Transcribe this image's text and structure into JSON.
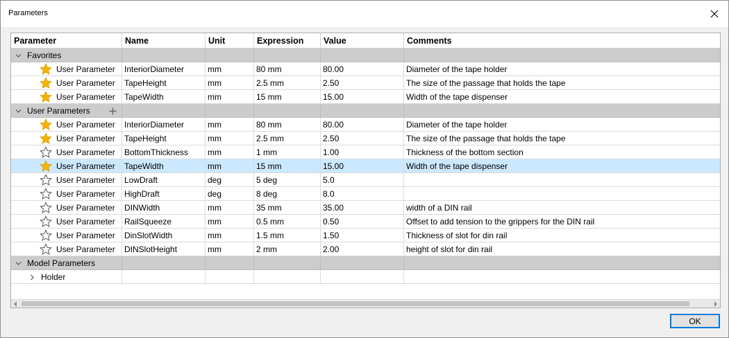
{
  "window": {
    "title": "Parameters"
  },
  "columns": [
    "Parameter",
    "Name",
    "Unit",
    "Expression",
    "Value",
    "Comments"
  ],
  "groups": {
    "favorites": {
      "label": "Favorites"
    },
    "user": {
      "label": "User Parameters"
    },
    "model": {
      "label": "Model Parameters"
    }
  },
  "favorites": [
    {
      "type": "User Parameter",
      "name": "InteriorDiameter",
      "unit": "mm",
      "expression": "80 mm",
      "value": "80.00",
      "comment": "Diameter of the tape holder",
      "starred": true
    },
    {
      "type": "User Parameter",
      "name": "TapeHeight",
      "unit": "mm",
      "expression": "2.5 mm",
      "value": "2.50",
      "comment": "The size of the passage that holds the tape",
      "starred": true
    },
    {
      "type": "User Parameter",
      "name": "TapeWidth",
      "unit": "mm",
      "expression": "15 mm",
      "value": "15.00",
      "comment": "Width of the tape dispenser",
      "starred": true
    }
  ],
  "user_parameters": [
    {
      "type": "User Parameter",
      "name": "InteriorDiameter",
      "unit": "mm",
      "expression": "80 mm",
      "value": "80.00",
      "comment": "Diameter of the tape holder",
      "starred": true
    },
    {
      "type": "User Parameter",
      "name": "TapeHeight",
      "unit": "mm",
      "expression": "2.5 mm",
      "value": "2.50",
      "comment": "The size of the passage that holds the tape",
      "starred": true
    },
    {
      "type": "User Parameter",
      "name": "BottomThickness",
      "unit": "mm",
      "expression": "1 mm",
      "value": "1.00",
      "comment": "Thickness of the bottom section",
      "starred": false
    },
    {
      "type": "User Parameter",
      "name": "TapeWidth",
      "unit": "mm",
      "expression": "15 mm",
      "value": "15.00",
      "comment": "Width of the tape dispenser",
      "starred": true,
      "selected": true
    },
    {
      "type": "User Parameter",
      "name": "LowDraft",
      "unit": "deg",
      "expression": "5 deg",
      "value": "5.0",
      "comment": "",
      "starred": false
    },
    {
      "type": "User Parameter",
      "name": "HighDraft",
      "unit": "deg",
      "expression": "8 deg",
      "value": "8.0",
      "comment": "",
      "starred": false
    },
    {
      "type": "User Parameter",
      "name": "DINWidth",
      "unit": "mm",
      "expression": "35 mm",
      "value": "35.00",
      "comment": "width of a DIN rail",
      "starred": false
    },
    {
      "type": "User Parameter",
      "name": "RailSqueeze",
      "unit": "mm",
      "expression": "0.5 mm",
      "value": "0.50",
      "comment": "Offset to add tension to the grippers for the DIN rail",
      "starred": false
    },
    {
      "type": "User Parameter",
      "name": "DinSlotWidth",
      "unit": "mm",
      "expression": "1.5 mm",
      "value": "1.50",
      "comment": "Thickness of slot for din rail",
      "starred": false
    },
    {
      "type": "User Parameter",
      "name": "DINSlotHeight",
      "unit": "mm",
      "expression": "2 mm",
      "value": "2.00",
      "comment": "height of slot for din rail",
      "starred": false
    }
  ],
  "model_parameters": [
    {
      "label": "Holder"
    }
  ],
  "buttons": {
    "ok": "OK"
  },
  "colors": {
    "star": "#f5b400",
    "selected_row": "#cce8ff",
    "group_row": "#cccccc",
    "accent": "#0078d7"
  },
  "icons": {
    "close": "close-icon",
    "star_filled": "star-filled-icon",
    "star_outline": "star-outline-icon",
    "add": "plus-icon",
    "expand": "chevron-down-icon",
    "collapsed": "chevron-right-icon"
  }
}
